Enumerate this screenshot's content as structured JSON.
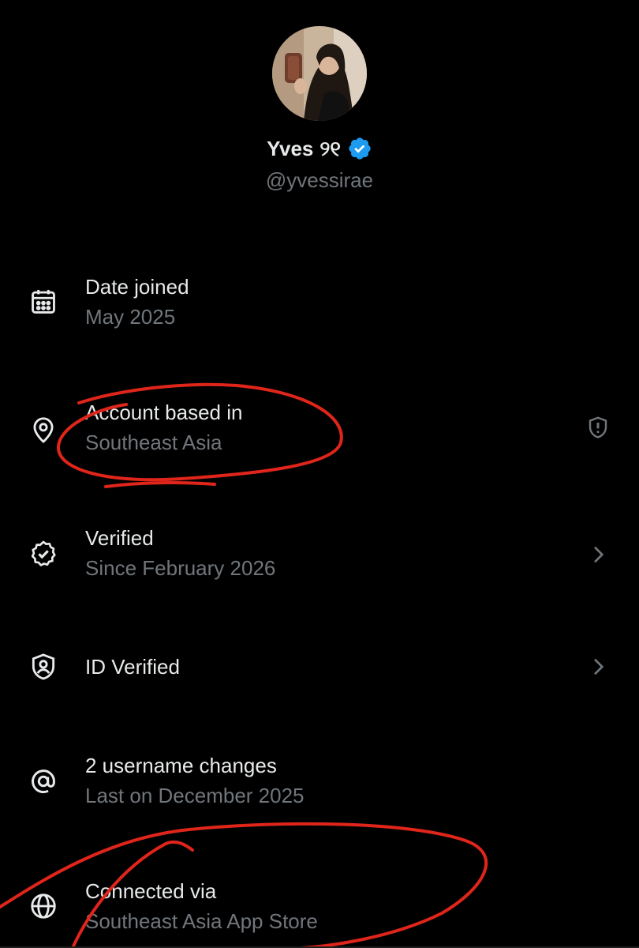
{
  "profile": {
    "display_name": "Yves",
    "name_suffix": "୨୧",
    "handle": "@yvessirae",
    "verified": true,
    "badge_color": "#1d9bf0"
  },
  "rows": [
    {
      "icon": "calendar-icon",
      "title": "Date joined",
      "subtitle": "May 2025"
    },
    {
      "icon": "location-pin-icon",
      "title": "Account based in",
      "subtitle": "Southeast Asia",
      "right_icon": "shield-alert-icon"
    },
    {
      "icon": "verified-check-icon",
      "title": "Verified",
      "subtitle": "Since February 2026",
      "right_icon": "chevron-right-icon"
    },
    {
      "icon": "id-shield-icon",
      "title": "ID Verified",
      "right_icon": "chevron-right-icon"
    },
    {
      "icon": "at-sign-icon",
      "title": "2 username changes",
      "subtitle": "Last on December 2025"
    },
    {
      "icon": "globe-icon",
      "title": "Connected via",
      "subtitle": "Southeast Asia App Store"
    }
  ],
  "colors": {
    "background": "#000000",
    "primary_text": "#e7e9ea",
    "secondary_text": "#71767b",
    "annotation": "#e0251b"
  }
}
